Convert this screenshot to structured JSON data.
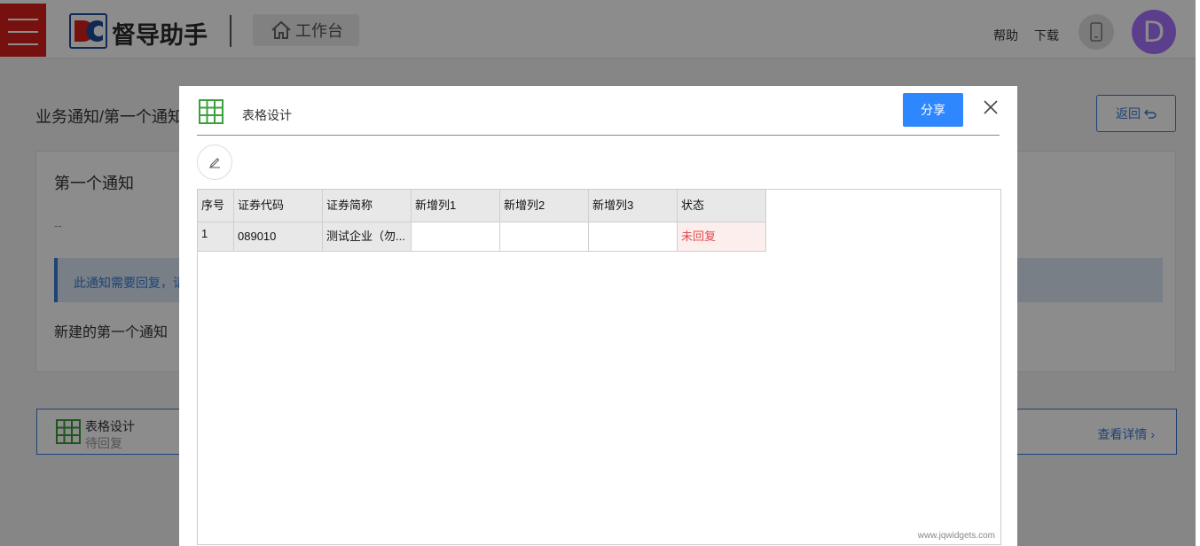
{
  "header": {
    "logo_text": "督导助手",
    "workbench_label": "工作台",
    "help_label": "帮助",
    "download_label": "下载",
    "avatar_letter": "D",
    "avatar_color": "#a874ff"
  },
  "page": {
    "breadcrumb": "业务通知/第一个通知",
    "back_label": "返回",
    "notice": {
      "title": "第一个通知",
      "dash": "--",
      "reply_prompt": "此通知需要回复，请",
      "body": "新建的第一个通知"
    },
    "attachment": {
      "title": "表格设计",
      "status": "待回复",
      "link_label": "查看详情"
    }
  },
  "modal": {
    "title": "表格设计",
    "share_label": "分享",
    "grid": {
      "columns": [
        "序号",
        "证券代码",
        "证券简称",
        "新增列1",
        "新增列2",
        "新增列3",
        "状态"
      ],
      "rows": [
        [
          "1",
          "089010",
          "测试企业（勿...",
          "",
          "",
          "",
          "未回复"
        ]
      ],
      "watermark": "www.jqwidgets.com"
    }
  },
  "colors": {
    "accent": "#2f87ff",
    "brand_red": "#d9201c",
    "status_unreplied": "#e04a4a",
    "link_blue": "#3a7bd5"
  }
}
